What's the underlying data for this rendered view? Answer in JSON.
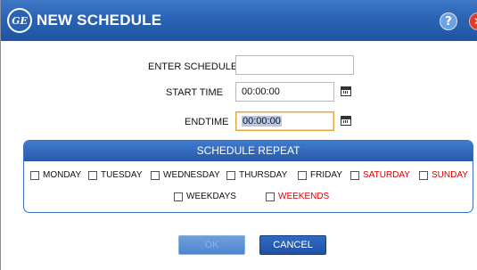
{
  "dialog": {
    "title": "NEW SCHEDULE",
    "logo_text": "GE",
    "help_glyph": "?",
    "close_glyph": "✕"
  },
  "form": {
    "schedule_label": "ENTER SCHEDULE",
    "schedule_value": "",
    "start_label": "START TIME",
    "start_value": "00:00:00",
    "end_label": "ENDTIME",
    "end_value": "00:00:00"
  },
  "repeat": {
    "header": "SCHEDULE REPEAT",
    "days": [
      {
        "label": "MONDAY",
        "checked": false,
        "color": "#111111"
      },
      {
        "label": "TUESDAY",
        "checked": false,
        "color": "#111111"
      },
      {
        "label": "WEDNESDAY",
        "checked": false,
        "color": "#111111"
      },
      {
        "label": "THURSDAY",
        "checked": false,
        "color": "#111111"
      },
      {
        "label": "FRIDAY",
        "checked": false,
        "color": "#111111"
      },
      {
        "label": "SATURDAY",
        "checked": false,
        "color": "#e00000"
      },
      {
        "label": "SUNDAY",
        "checked": false,
        "color": "#e00000"
      }
    ],
    "groups": [
      {
        "label": "WEEKDAYS",
        "checked": false,
        "color": "#111111"
      },
      {
        "label": "WEEKENDS",
        "checked": false,
        "color": "#e00000"
      }
    ]
  },
  "buttons": {
    "ok_label": "OK",
    "cancel_label": "CANCEL"
  },
  "colors": {
    "title_bar": "#2b63b4",
    "weekend_text": "#e00000",
    "focus_border": "#e0a63b"
  },
  "icons": {
    "logo": "ge-logo-icon",
    "help": "help-icon",
    "close": "close-icon",
    "calendar": "calendar-icon"
  }
}
